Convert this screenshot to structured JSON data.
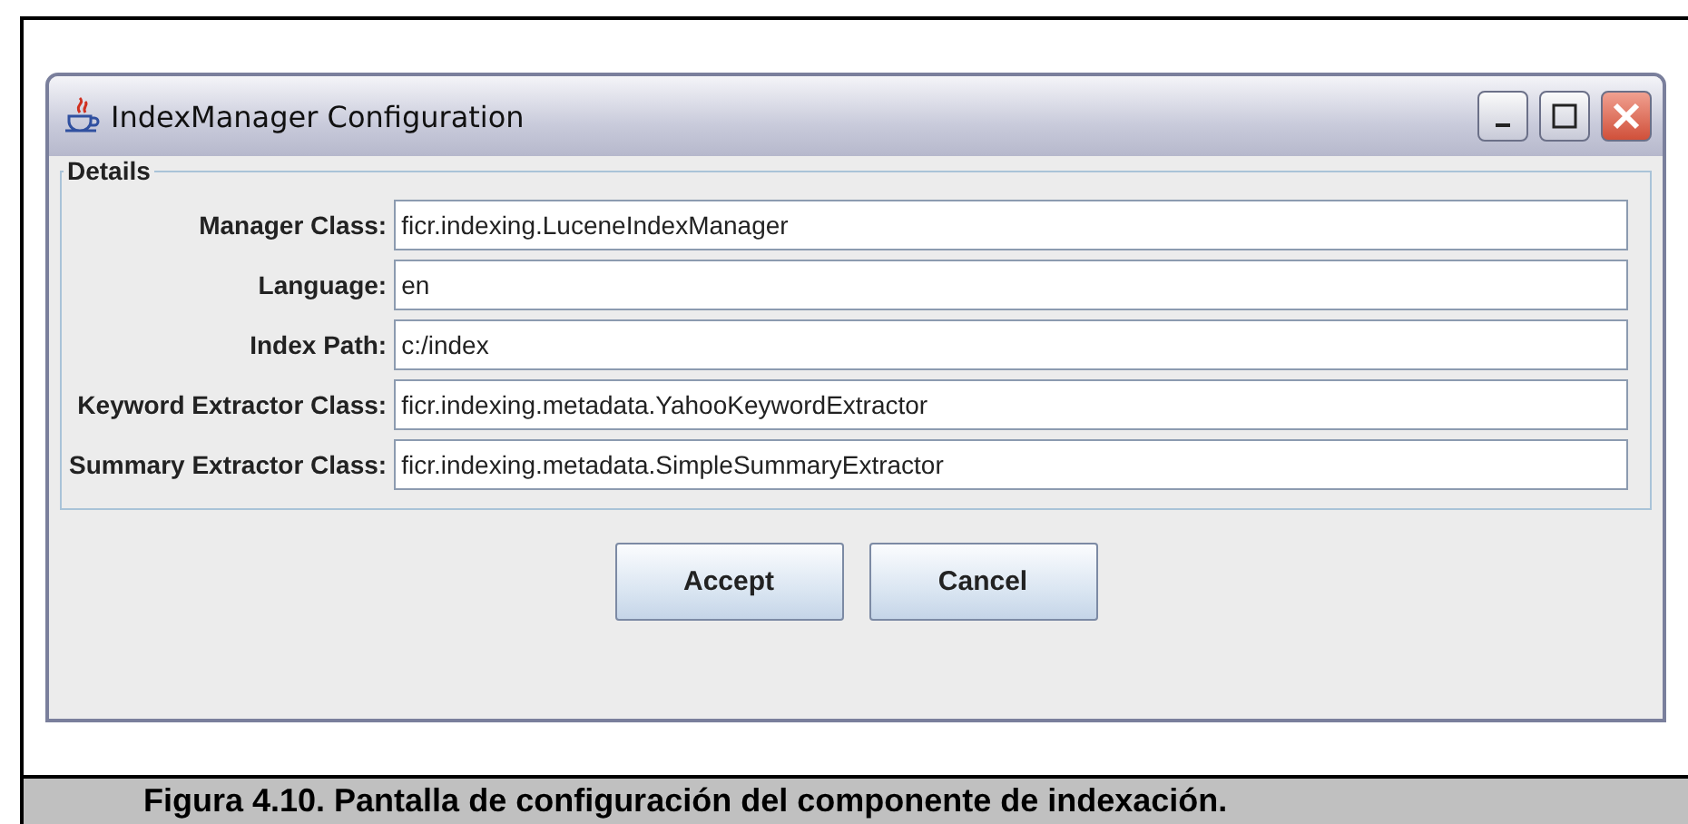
{
  "window": {
    "title": "IndexManager Configuration"
  },
  "group": {
    "title": "Details"
  },
  "fields": [
    {
      "label": "Manager Class:",
      "value": "ficr.indexing.LuceneIndexManager"
    },
    {
      "label": "Language:",
      "value": "en"
    },
    {
      "label": "Index Path:",
      "value": "c:/index"
    },
    {
      "label": "Keyword Extractor Class:",
      "value": "ficr.indexing.metadata.YahooKeywordExtractor"
    },
    {
      "label": "Summary Extractor Class:",
      "value": "ficr.indexing.metadata.SimpleSummaryExtractor"
    }
  ],
  "buttons": [
    "Accept",
    "Cancel"
  ],
  "caption": "Figura 4.10. Pantalla de configuración del componente de indexación."
}
